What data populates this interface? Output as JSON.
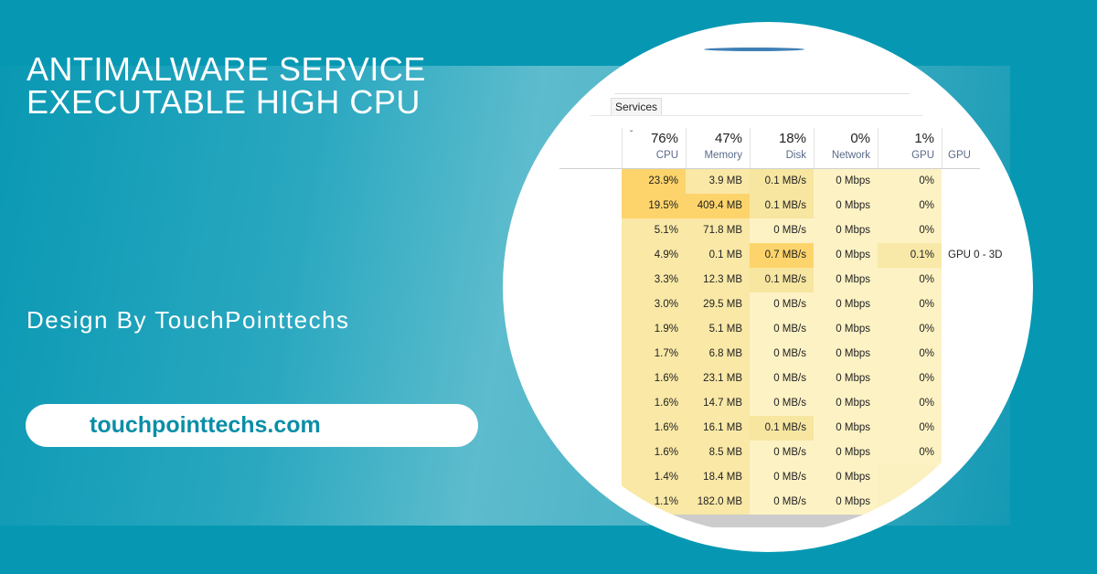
{
  "banner": {
    "title_lines": [
      "ANTIMALWARE SERVICE",
      "EXECUTABLE HIGH CPU"
    ],
    "byline": "Design By TouchPointtechs",
    "url": "touchpointtechs.com",
    "colors": {
      "background": "#0698b2",
      "accent_text": "#0a8ea7",
      "text": "#ffffff"
    }
  },
  "task_manager": {
    "tab": "Services",
    "sort_icon": "chevron-down-icon",
    "columns": [
      {
        "key": "cpu",
        "total": "76%",
        "label": "CPU"
      },
      {
        "key": "memory",
        "total": "47%",
        "label": "Memory"
      },
      {
        "key": "disk",
        "total": "18%",
        "label": "Disk"
      },
      {
        "key": "network",
        "total": "0%",
        "label": "Network"
      },
      {
        "key": "gpu",
        "total": "1%",
        "label": "GPU"
      },
      {
        "key": "gpu_engine",
        "total": "",
        "label": "GPU"
      }
    ],
    "rows": [
      {
        "cpu": "23.9%",
        "memory": "3.9 MB",
        "disk": "0.1 MB/s",
        "network": "0 Mbps",
        "gpu": "0%",
        "gpu_engine": ""
      },
      {
        "cpu": "19.5%",
        "memory": "409.4 MB",
        "disk": "0.1 MB/s",
        "network": "0 Mbps",
        "gpu": "0%",
        "gpu_engine": ""
      },
      {
        "cpu": "5.1%",
        "memory": "71.8 MB",
        "disk": "0 MB/s",
        "network": "0 Mbps",
        "gpu": "0%",
        "gpu_engine": ""
      },
      {
        "cpu": "4.9%",
        "memory": "0.1 MB",
        "disk": "0.7 MB/s",
        "network": "0 Mbps",
        "gpu": "0.1%",
        "gpu_engine": "GPU 0 - 3D"
      },
      {
        "cpu": "3.3%",
        "memory": "12.3 MB",
        "disk": "0.1 MB/s",
        "network": "0 Mbps",
        "gpu": "0%",
        "gpu_engine": ""
      },
      {
        "cpu": "3.0%",
        "memory": "29.5 MB",
        "disk": "0 MB/s",
        "network": "0 Mbps",
        "gpu": "0%",
        "gpu_engine": ""
      },
      {
        "cpu": "1.9%",
        "memory": "5.1 MB",
        "disk": "0 MB/s",
        "network": "0 Mbps",
        "gpu": "0%",
        "gpu_engine": ""
      },
      {
        "cpu": "1.7%",
        "memory": "6.8 MB",
        "disk": "0 MB/s",
        "network": "0 Mbps",
        "gpu": "0%",
        "gpu_engine": ""
      },
      {
        "cpu": "1.6%",
        "memory": "23.1 MB",
        "disk": "0 MB/s",
        "network": "0 Mbps",
        "gpu": "0%",
        "gpu_engine": ""
      },
      {
        "cpu": "1.6%",
        "memory": "14.7 MB",
        "disk": "0 MB/s",
        "network": "0 Mbps",
        "gpu": "0%",
        "gpu_engine": ""
      },
      {
        "cpu": "1.6%",
        "memory": "16.1 MB",
        "disk": "0.1 MB/s",
        "network": "0 Mbps",
        "gpu": "0%",
        "gpu_engine": ""
      },
      {
        "cpu": "1.6%",
        "memory": "8.5 MB",
        "disk": "0 MB/s",
        "network": "0 Mbps",
        "gpu": "0%",
        "gpu_engine": ""
      },
      {
        "cpu": "1.4%",
        "memory": "18.4 MB",
        "disk": "0 MB/s",
        "network": "0 Mbps",
        "gpu": "",
        "gpu_engine": ""
      },
      {
        "cpu": "1.1%",
        "memory": "182.0 MB",
        "disk": "0 MB/s",
        "network": "0 Mbps",
        "gpu": "",
        "gpu_engine": ""
      }
    ],
    "heat_colors": {
      "high": "#fdd46b",
      "mid": "#f9e8a6",
      "low": "#fdf2c4",
      "base": "#fbf0c0"
    }
  }
}
